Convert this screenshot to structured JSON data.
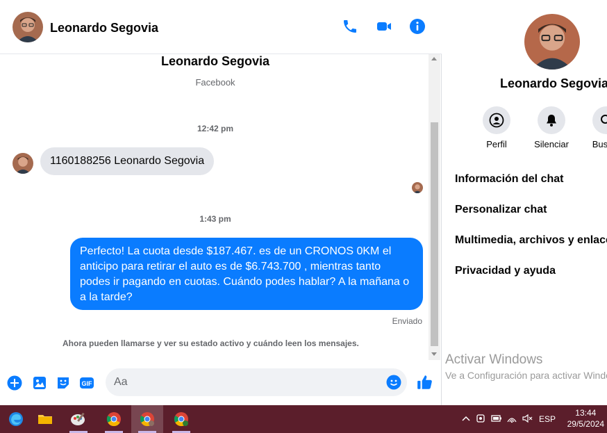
{
  "contact": {
    "name": "Leonardo Segovia",
    "source": "Facebook"
  },
  "colors": {
    "accent": "#0a7cff",
    "bubble_in": "#e4e6eb",
    "taskbar": "#5b1e2b"
  },
  "header": {
    "icons": [
      "phone-icon",
      "video-camera-icon",
      "info-icon"
    ]
  },
  "messages": {
    "time1": "12:42 pm",
    "incoming_text": "1160188256 Leonardo Segovia",
    "time2": "1:43 pm",
    "outgoing_text": "Perfecto! La cuota desde $187.467. es de un CRONOS 0KM el anticipo para retirar el auto es de $6.743.700 , mientras tanto podes ir pagando en cuotas. Cuándo podes hablar? A la mañana o a la tarde?",
    "sent_status": "Enviado",
    "system_message": "Ahora pueden llamarse y ver su estado activo y cuándo leen los mensajes."
  },
  "composer": {
    "placeholder": "Aa",
    "gif_label": "GIF"
  },
  "details": {
    "actions": [
      {
        "label": "Perfil",
        "icon": "profile-icon"
      },
      {
        "label": "Silenciar",
        "icon": "bell-icon"
      },
      {
        "label": "Buscar",
        "icon": "search-icon"
      }
    ],
    "menu": [
      "Información del chat",
      "Personalizar chat",
      "Multimedia, archivos y enlaces",
      "Privacidad y ayuda"
    ]
  },
  "watermark": {
    "title": "Activar Windows",
    "subtitle": "Ve a Configuración para activar Windows."
  },
  "taskbar": {
    "apps": [
      "edge-icon",
      "file-explorer-icon",
      "paint-icon",
      "chrome-icon",
      "chrome-profile-icon",
      "chrome-icon"
    ],
    "lang": "ESP",
    "time": "13:44",
    "date": "29/5/2024"
  }
}
